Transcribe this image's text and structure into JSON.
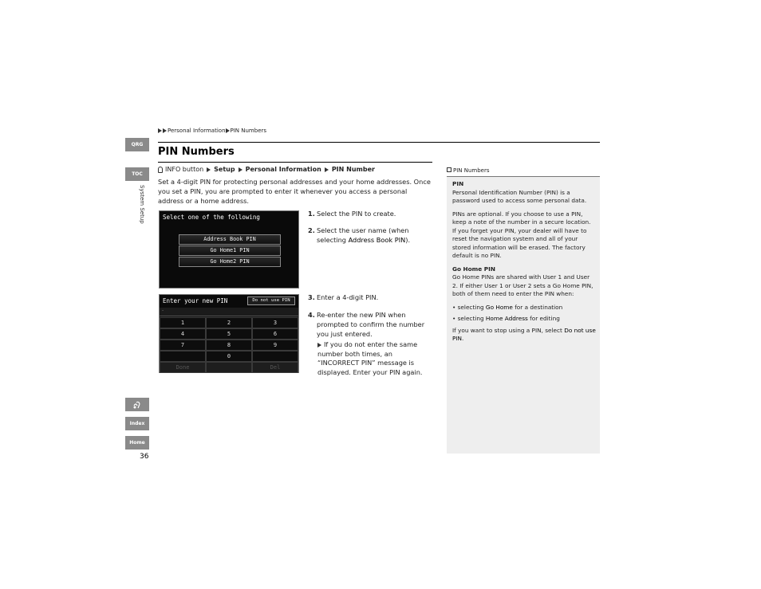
{
  "breadcrumb": {
    "item1": "Personal Information",
    "item2": "PIN Numbers"
  },
  "page_title": "PIN Numbers",
  "side_nav": {
    "qrg": "QRG",
    "toc": "TOC",
    "section_label": "System Setup",
    "voice": "",
    "index": "Index",
    "home": "Home"
  },
  "page_number": "36",
  "path": {
    "start": "INFO button",
    "step1": "Setup",
    "step2": "Personal Information",
    "step3": "PIN Number"
  },
  "intro": "Set a 4-digit PIN for protecting personal addresses and your home addresses. Once you set a PIN, you are prompted to enter it whenever you access a personal address or a home address.",
  "screen1": {
    "title": "Select one of the following",
    "buttons": [
      "Address Book PIN",
      "Go Home1 PIN",
      "Go Home2 PIN"
    ]
  },
  "screen2": {
    "title": "Enter your new PIN",
    "action_button": "Do not use PIN",
    "entry": "-",
    "keys": [
      "1",
      "2",
      "3",
      "4",
      "5",
      "6",
      "7",
      "8",
      "9",
      "",
      "0",
      "",
      "Done",
      "",
      "Del"
    ]
  },
  "steps": [
    {
      "num": "1.",
      "text": "Select the PIN to create."
    },
    {
      "num": "2.",
      "text_pre": "Select the user name (when selecting ",
      "text_em": "Address Book PIN",
      "text_post": ")."
    },
    {
      "num": "3.",
      "text": "Enter a 4-digit PIN."
    },
    {
      "num": "4.",
      "text": "Re-enter the new PIN when prompted to confirm the number you just entered."
    }
  ],
  "step4_note": "If you do not enter the same number both times, an “INCORRECT PIN” message is displayed. Enter your PIN again.",
  "sidebar": {
    "header": "PIN Numbers",
    "pin_heading": "PIN",
    "pin_def": "Personal Identification Number (PIN) is a password used to access some personal data.",
    "pin_optional": "PINs are optional. If you choose to use a PIN, keep a note of the number in a secure location. If you forget your PIN, your dealer will have to reset the navigation system and all of your stored information will be erased. The factory default is no PIN.",
    "gohome_heading": "Go Home PIN",
    "gohome_text": "Go Home PINs are shared with User 1 and User 2. If either User 1 or User 2 sets a Go Home PIN, both of them need to enter the PIN when:",
    "bullet1_pre": "selecting ",
    "bullet1_em": "Go Home",
    "bullet1_post": " for a destination",
    "bullet2_pre": "selecting ",
    "bullet2_em": "Home Address",
    "bullet2_post": " for editing",
    "stop_pre": "If you want to stop using a PIN, select ",
    "stop_em": "Do not use PIN",
    "stop_post": "."
  }
}
